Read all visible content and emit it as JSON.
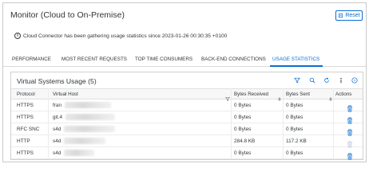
{
  "header": {
    "title": "Monitor (Cloud to On-Premise)",
    "reset_label": "Reset"
  },
  "info": {
    "message": "Cloud Connector has been gathering usage statistics since 2023-01-26 00:30:35 +0100"
  },
  "tabs": [
    {
      "label": "PERFORMANCE",
      "active": false
    },
    {
      "label": "MOST RECENT REQUESTS",
      "active": false
    },
    {
      "label": "TOP TIME CONSUMERS",
      "active": false
    },
    {
      "label": "BACK-END CONNECTIONS",
      "active": false
    },
    {
      "label": "USAGE STATISTICS",
      "active": true
    }
  ],
  "panel": {
    "title": "Virtual Systems Usage",
    "count": "(5)"
  },
  "table": {
    "columns": [
      "Protocol",
      "Virtual Host",
      "Bytes Received",
      "Bytes Sent",
      "Actions"
    ],
    "rows": [
      {
        "protocol": "HTTPS",
        "host": "fran",
        "received": "0 Bytes",
        "sent": "0 Bytes"
      },
      {
        "protocol": "HTTPS",
        "host": "git.4",
        "received": "0 Bytes",
        "sent": "0 Bytes"
      },
      {
        "protocol": "RFC SNC",
        "host": "s4d",
        "received": "0 Bytes",
        "sent": "0 Bytes"
      },
      {
        "protocol": "HTTP",
        "host": "s4d",
        "received": "284.8 KB",
        "sent": "117.2 KB"
      },
      {
        "protocol": "HTTPS",
        "host": "s4d",
        "received": "0 Bytes",
        "sent": "0 Bytes"
      }
    ]
  },
  "colors": {
    "accent": "#0a6ed1",
    "text": "#32363a"
  },
  "icons": [
    "reset-icon",
    "info-icon",
    "filter-icon",
    "search-icon",
    "refresh-icon",
    "info-detail-icon",
    "help-icon",
    "sort-icon",
    "trash-icon"
  ]
}
